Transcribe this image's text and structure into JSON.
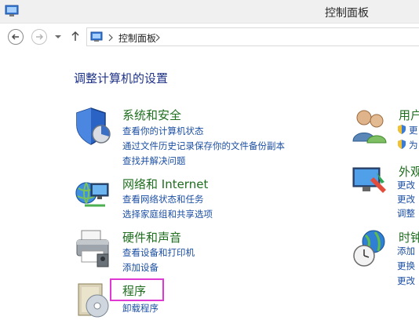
{
  "window": {
    "title": "控制面板"
  },
  "address_bar": {
    "crumb": "控制面板"
  },
  "main": {
    "heading": "调整计算机的设置"
  },
  "categories": {
    "system_security": {
      "title": "系统和安全",
      "links": [
        "查看你的计算机状态",
        "通过文件历史记录保存你的文件备份副本",
        "查找并解决问题"
      ]
    },
    "network": {
      "title": "网络和 Internet",
      "links": [
        "查看网络状态和任务",
        "选择家庭组和共享选项"
      ]
    },
    "hardware": {
      "title": "硬件和声音",
      "links": [
        "查看设备和打印机",
        "添加设备"
      ]
    },
    "programs": {
      "title": "程序",
      "links": [
        "卸载程序"
      ]
    },
    "user_accounts": {
      "title": "用户",
      "links": [
        "更",
        "为"
      ]
    },
    "appearance": {
      "title": "外观",
      "links": [
        "更改",
        "更改",
        "调整"
      ]
    },
    "clock": {
      "title": "时钟",
      "links": [
        "添加",
        "更换",
        "更改"
      ]
    }
  },
  "colors": {
    "heading": "#1e3287",
    "category_title": "#1e6e1e",
    "link": "#1c4fa3",
    "highlight": "#e038d2"
  }
}
